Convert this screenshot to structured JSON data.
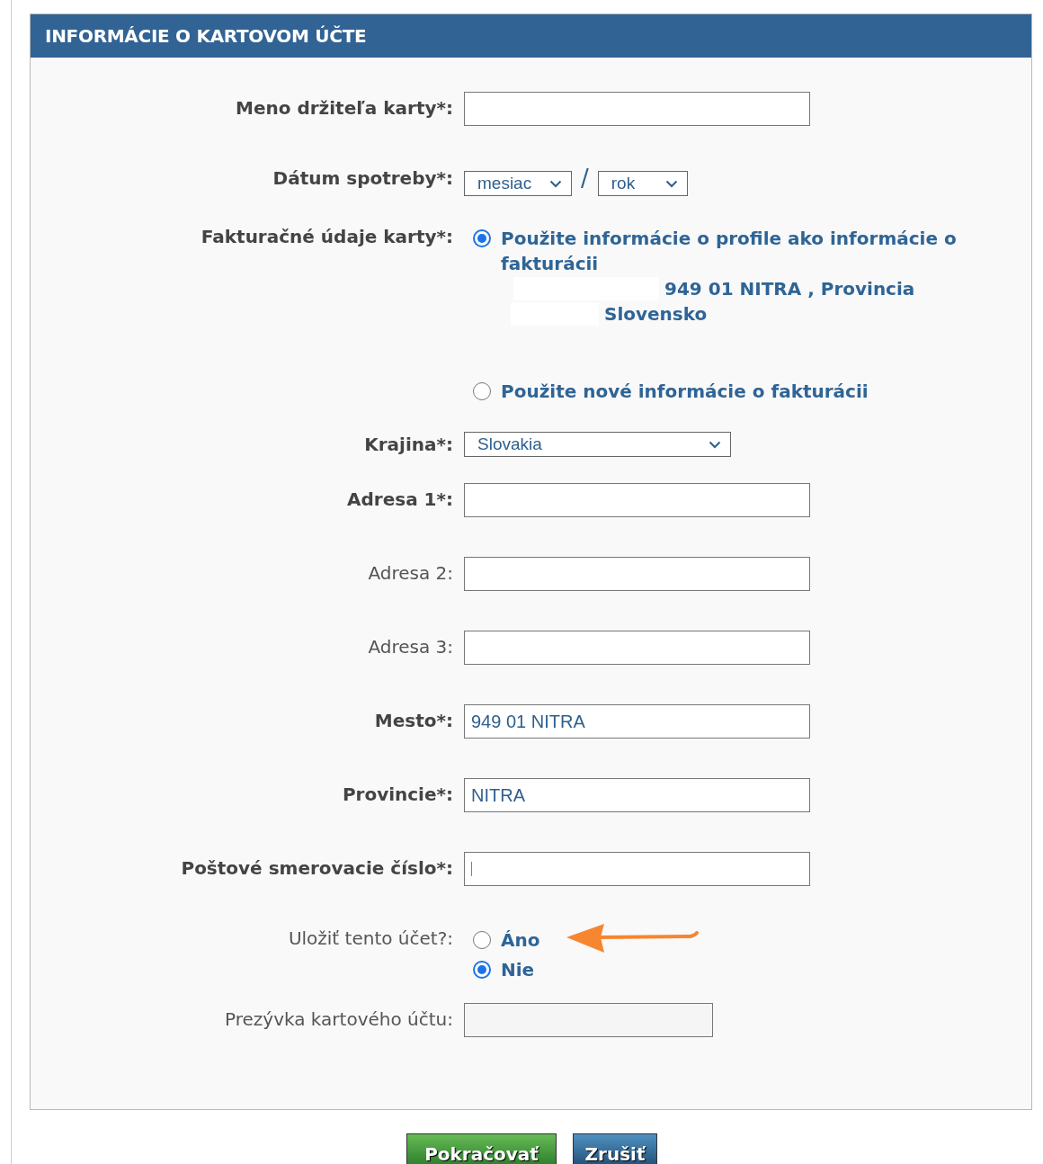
{
  "section": {
    "title": "INFORMÁCIE O KARTOVOM ÚČTE"
  },
  "fields": [
    {
      "kind": "text",
      "label": "Meno držiteľa karty*:",
      "required": true
    },
    {
      "kind": "date",
      "label": "Dátum spotreby*:",
      "required": true,
      "month": "mesiac",
      "separator": "/",
      "year": "rok"
    },
    {
      "kind": "billing",
      "label": "Fakturačné údaje karty*:",
      "required": true,
      "options": [
        {
          "label": "Použite informácie o profile ako informácie o fakturácii",
          "selected": true,
          "address": [
            {
              "text": "949 01 NITRA , Provincia",
              "redacted": true
            },
            {
              "text": "Slovensko",
              "redacted": true
            }
          ]
        },
        {
          "label": "Použite nové informácie o fakturácii",
          "selected": false
        }
      ]
    },
    {
      "kind": "select",
      "label": "Krajina*:",
      "required": true,
      "value": "Slovakia"
    },
    {
      "kind": "text",
      "label": "Adresa 1*:",
      "required": true
    },
    {
      "kind": "text",
      "label": "Adresa 2:",
      "required": false
    },
    {
      "kind": "text",
      "label": "Adresa 3:",
      "required": false
    },
    {
      "kind": "text",
      "label": "Mesto*:",
      "required": true,
      "value": "949 01 NITRA"
    },
    {
      "kind": "text",
      "label": "Provincie*:",
      "required": true,
      "value": "NITRA"
    },
    {
      "kind": "text",
      "label": "Poštové smerovacie číslo*:",
      "required": true,
      "focused": true
    },
    {
      "kind": "radio",
      "label": "Uložiť tento účet?:",
      "required": false,
      "annotated": true,
      "options": [
        {
          "label": "Áno",
          "selected": false
        },
        {
          "label": "Nie",
          "selected": true
        }
      ]
    },
    {
      "kind": "text",
      "label": "Prezývka kartového účtu:",
      "required": false,
      "disabled": true
    }
  ],
  "buttons": [
    {
      "label": "Pokračovať",
      "kind": "primary"
    },
    {
      "label": "Zrušiť",
      "kind": "secondary"
    }
  ]
}
